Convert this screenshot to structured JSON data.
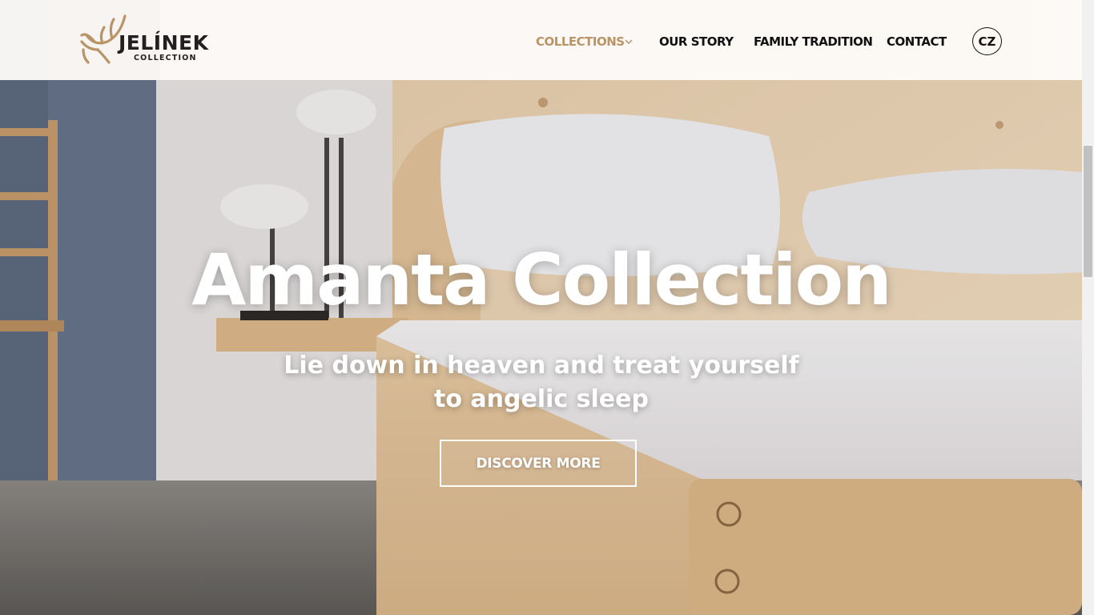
{
  "brand": {
    "name": "JELÍNEK",
    "subtitle": "COLLECTION",
    "accent_color": "#b89466"
  },
  "nav": {
    "items": [
      {
        "label": "COLLECTIONS",
        "active": true,
        "has_dropdown": true
      },
      {
        "label": "OUR STORY"
      },
      {
        "label": "FAMILY TRADITION"
      },
      {
        "label": "CONTACT"
      }
    ],
    "language": "CZ"
  },
  "hero": {
    "title": "Amanta Collection",
    "subtitle": "Lie down in heaven and treat yourself to angelic sleep",
    "cta": "DISCOVER MORE"
  }
}
